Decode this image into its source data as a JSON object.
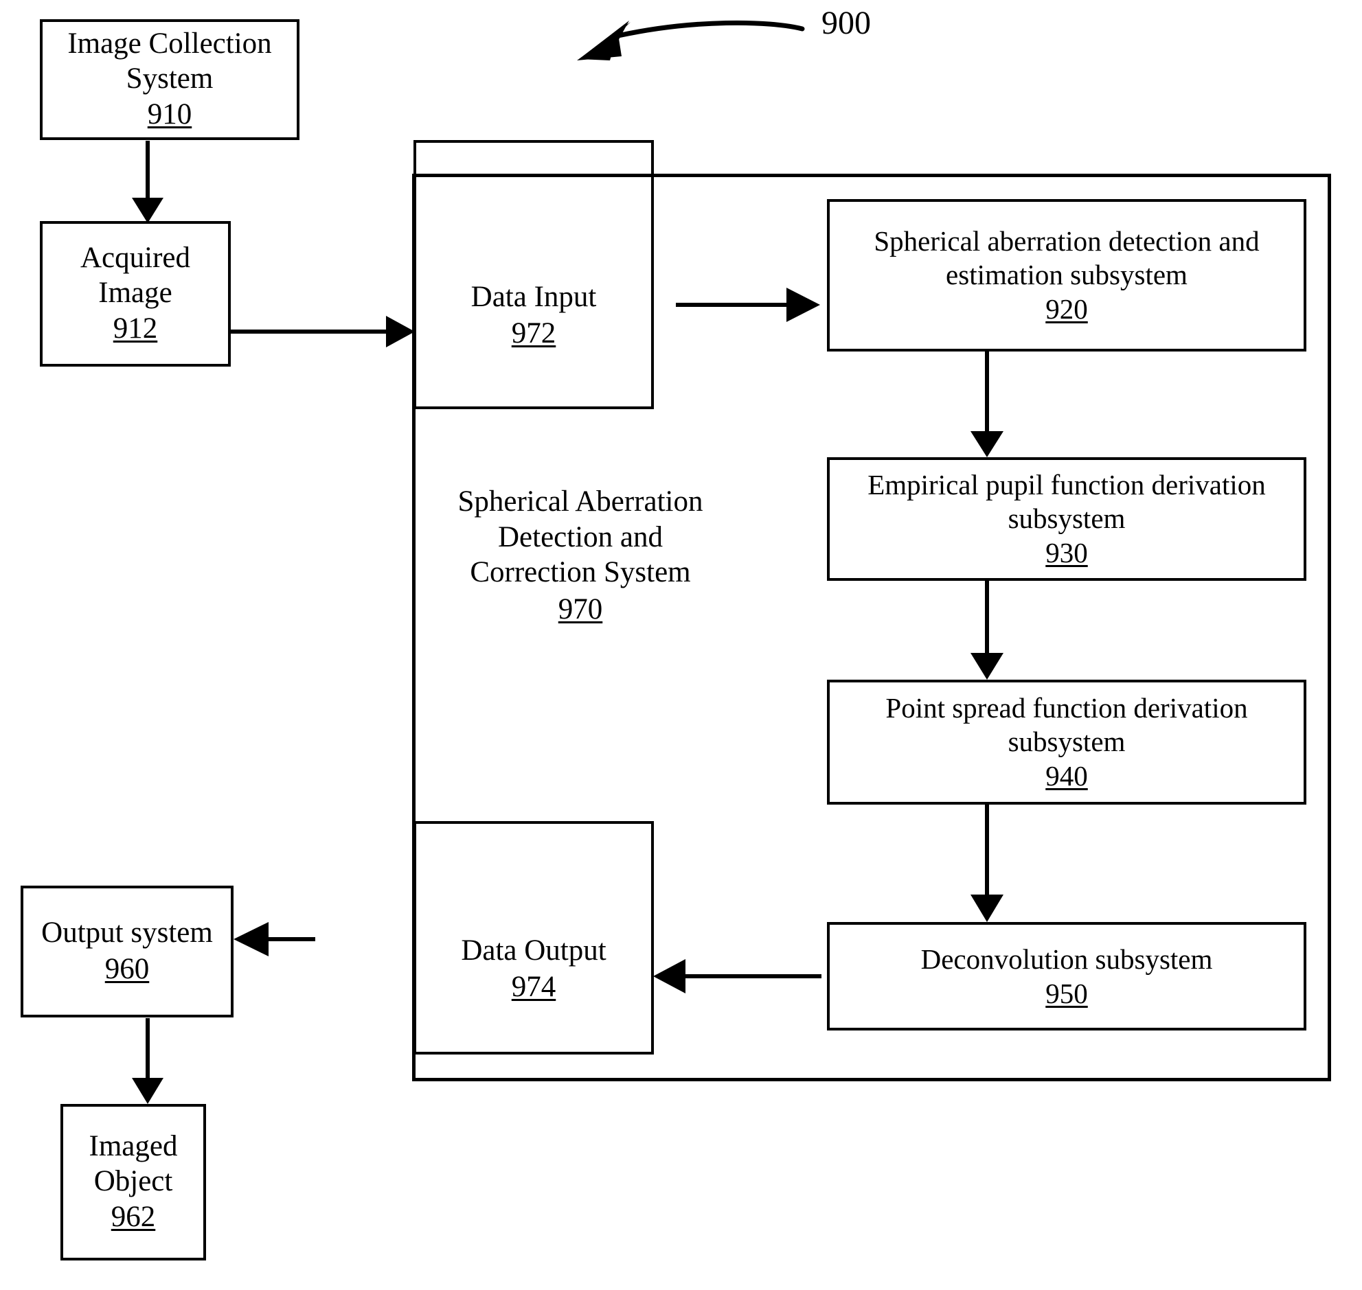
{
  "figure": {
    "number": "900",
    "pointer_icon": "curved-arrow-icon"
  },
  "boxes": {
    "image_collection_system": {
      "title": "Image Collection System",
      "ref": "910"
    },
    "acquired_image": {
      "title": "Acquired Image",
      "ref": "912"
    },
    "data_input": {
      "title": "Data Input",
      "ref": "972"
    },
    "data_output": {
      "title": "Data Output",
      "ref": "974"
    },
    "spherical_aberration_detection": {
      "title": "Spherical aberration detection and estimation subsystem",
      "ref": "920"
    },
    "empirical_pupil_function": {
      "title": "Empirical pupil function derivation subsystem",
      "ref": "930"
    },
    "point_spread_function": {
      "title": "Point spread function derivation subsystem",
      "ref": "940"
    },
    "deconvolution": {
      "title": "Deconvolution subsystem",
      "ref": "950"
    },
    "output_system": {
      "title": "Output system",
      "ref": "960"
    },
    "imaged_object": {
      "title": "Imaged Object",
      "ref": "962"
    }
  },
  "system_container": {
    "title_line_1": "Spherical Aberration",
    "title_line_2": "Detection and",
    "title_line_3": "Correction System",
    "ref": "970"
  },
  "connectors": [
    {
      "name": "image-collection-to-acquired-image",
      "from": "910",
      "to": "912",
      "direction": "down"
    },
    {
      "name": "acquired-image-to-data-input",
      "from": "912",
      "to": "972",
      "direction": "right"
    },
    {
      "name": "data-input-to-detection",
      "from": "972",
      "to": "920",
      "direction": "right"
    },
    {
      "name": "detection-to-pupil-function",
      "from": "920",
      "to": "930",
      "direction": "down"
    },
    {
      "name": "pupil-function-to-psf",
      "from": "930",
      "to": "940",
      "direction": "down"
    },
    {
      "name": "psf-to-deconvolution",
      "from": "940",
      "to": "950",
      "direction": "down"
    },
    {
      "name": "deconvolution-to-data-output",
      "from": "950",
      "to": "974",
      "direction": "left"
    },
    {
      "name": "data-output-to-output-system",
      "from": "974",
      "to": "960",
      "direction": "left"
    },
    {
      "name": "output-system-to-imaged-object",
      "from": "960",
      "to": "962",
      "direction": "down"
    }
  ],
  "colors": {
    "stroke": "#000000",
    "background": "#ffffff"
  }
}
